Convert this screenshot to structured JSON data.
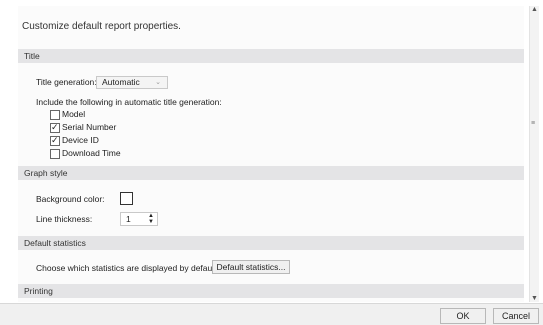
{
  "dialog": {
    "intro": "Customize default report properties."
  },
  "title_section": {
    "header": "Title",
    "generation_label": "Title generation:",
    "generation_value": "Automatic",
    "include_label": "Include the following in automatic title generation:",
    "checkboxes": [
      {
        "label": "Model",
        "checked": false
      },
      {
        "label": "Serial Number",
        "checked": true
      },
      {
        "label": "Device ID",
        "checked": true
      },
      {
        "label": "Download Time",
        "checked": false
      }
    ]
  },
  "graph_section": {
    "header": "Graph style",
    "background_label": "Background color:",
    "thickness_label": "Line thickness:",
    "thickness_value": "1"
  },
  "stats_section": {
    "header": "Default statistics",
    "choose_label": "Choose which statistics are displayed by default:",
    "button_label": "Default statistics..."
  },
  "printing_section": {
    "header": "Printing"
  },
  "footer": {
    "ok_label": "OK",
    "cancel_label": "Cancel"
  },
  "colors": {
    "section_bg": "#e4e4e6",
    "background_swatch": "#ffffff"
  }
}
